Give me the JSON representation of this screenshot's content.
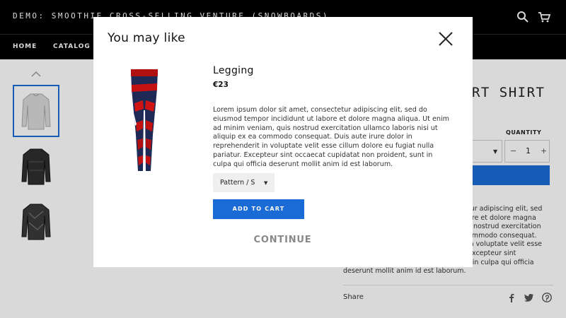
{
  "header": {
    "store_title": "DEMO: SMOOTHIE CROSS-SELLING VENTURE (SNOWBOARDS)",
    "search_icon": "search-icon",
    "cart_icon": "cart-icon"
  },
  "nav": {
    "items": [
      "HOME",
      "CATALOG"
    ]
  },
  "product": {
    "title": "ORT SHIRT",
    "quantity_label": "QUANTITY",
    "quantity_value": "1",
    "quantity_minus": "−",
    "quantity_plus": "+",
    "description_lines": [
      "tur adipiscing elit, sed",
      "ore et dolore magna",
      "s nostrud exercitation",
      "ommodo consequat.",
      "in voluptate velit esse",
      "Excepteur sint",
      "t in culpa qui officia",
      "deserunt mollit anim id est laborum."
    ],
    "share_label": "Share",
    "social_icons": [
      "facebook-icon",
      "twitter-icon",
      "pinterest-icon"
    ]
  },
  "modal": {
    "title": "You may like",
    "close_icon": "close-icon",
    "product_name": "Legging",
    "price": "€23",
    "description_lines": [
      "Lorem ipsum dolor sit amet, consectetur adipiscing elit, sed do",
      "eiusmod tempor incididunt ut labore et dolore magna aliqua. Ut enim",
      "ad minim veniam, quis nostrud exercitation ullamco laboris nisi ut",
      "aliquip ex ea commodo consequat. Duis aute irure dolor in",
      "reprehenderit in voluptate velit esse cillum dolore eu fugiat nulla",
      "pariatur. Excepteur sint occaecat cupidatat non proident, sunt in",
      "culpa qui officia deserunt mollit anim id est laborum."
    ],
    "variant_selected": "Pattern / S",
    "add_to_cart_label": "ADD TO CART",
    "continue_label": "CONTINUE"
  },
  "colors": {
    "accent": "#1a6bd6",
    "header_bg": "#000000"
  }
}
